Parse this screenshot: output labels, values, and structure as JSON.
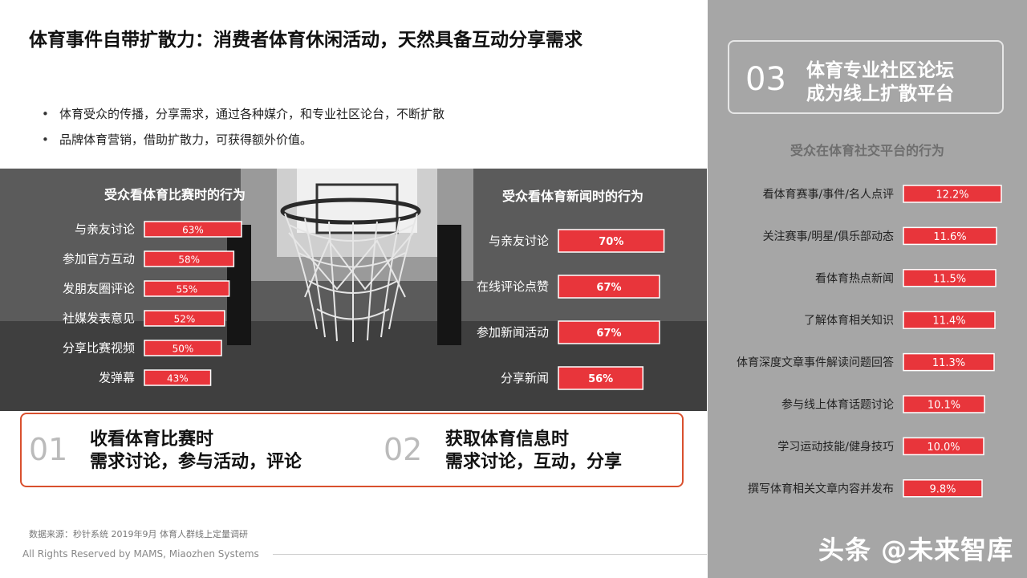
{
  "page_title": "体育事件自带扩散力：消费者体育休闲活动，天然具备互动分享需求",
  "bullets": [
    "体育受众的传播，分享需求，通过各种媒介，和专业社区论台，不断扩散",
    "品牌体育营销，借助扩散力，可获得额外价值。"
  ],
  "colors": {
    "bar_red": "#e8353b",
    "callout_border": "#d9502e",
    "panel_grey": "#a6a6a6"
  },
  "callouts": [
    {
      "num": "01",
      "line1": "收看体育比赛时",
      "line2": "需求讨论，参与活动，评论"
    },
    {
      "num": "02",
      "line1": "获取体育信息时",
      "line2": "需求讨论，互动，分享"
    }
  ],
  "panel": {
    "num": "03",
    "line1": "体育专业社区论坛",
    "line2": "成为线上扩散平台",
    "subtitle": "受众在体育社交平台的行为"
  },
  "source": "数据来源：秒针系统  2019年9月  体育人群线上定量调研",
  "rights": "All Rights Reserved by MAMS, Miaozhen Systems",
  "watermark": "头条 @未来智库",
  "chart_data": [
    {
      "type": "bar",
      "orientation": "horizontal",
      "title": "受众看体育比赛时的行为",
      "categories": [
        "与亲友讨论",
        "参加官方互动",
        "发朋友圈评论",
        "社媒发表意见",
        "分享比赛视频",
        "发弹幕"
      ],
      "values": [
        63,
        58,
        55,
        52,
        50,
        43
      ],
      "labels": [
        "63%",
        "58%",
        "55%",
        "52%",
        "50%",
        "43%"
      ],
      "unit": "%",
      "xlim": [
        0,
        100
      ]
    },
    {
      "type": "bar",
      "orientation": "horizontal",
      "title": "受众看体育新闻时的行为",
      "categories": [
        "与亲友讨论",
        "在线评论点赞",
        "参加新闻活动",
        "分享新闻"
      ],
      "values": [
        70,
        67,
        67,
        56
      ],
      "labels": [
        "70%",
        "67%",
        "67%",
        "56%"
      ],
      "unit": "%",
      "xlim": [
        0,
        100
      ]
    },
    {
      "type": "bar",
      "orientation": "horizontal",
      "title": "受众在体育社交平台的行为",
      "categories": [
        "看体育赛事/事件/名人点评",
        "关注赛事/明星/俱乐部动态",
        "看体育热点新闻",
        "了解体育相关知识",
        "体育深度文章事件解读问题回答",
        "参与线上体育话题讨论",
        "学习运动技能/健身技巧",
        "撰写体育相关文章内容并发布"
      ],
      "values": [
        12.2,
        11.6,
        11.5,
        11.4,
        11.3,
        10.1,
        10.0,
        9.8
      ],
      "labels": [
        "12.2%",
        "11.6%",
        "11.5%",
        "11.4%",
        "11.3%",
        "10.1%",
        "10.0%",
        "9.8%"
      ],
      "unit": "%",
      "xlim": [
        0,
        12.2
      ]
    }
  ]
}
